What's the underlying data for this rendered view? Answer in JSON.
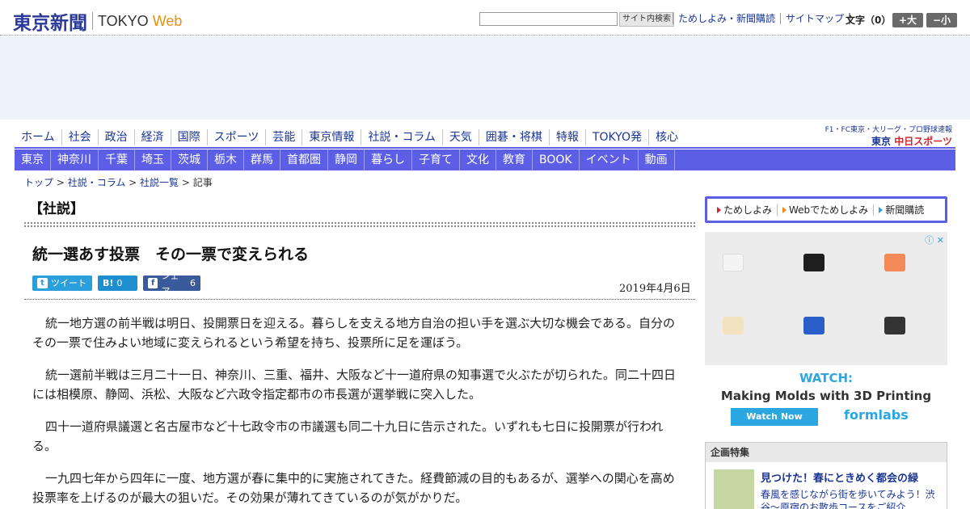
{
  "header": {
    "logo_jp": "東京新聞",
    "logo_en": "TOKYO",
    "logo_web": "Web",
    "search_button": "サイト内検索",
    "links": [
      "ためしよみ・新聞購読",
      "サイトマップ"
    ],
    "font_size_label": "文字（0）",
    "font_up": "+大",
    "font_down": "−小"
  },
  "nav_primary": [
    "ホーム",
    "社会",
    "政治",
    "経済",
    "国際",
    "スポーツ",
    "芸能",
    "東京情報",
    "社説・コラム",
    "天気",
    "囲碁・将棋",
    "特報",
    "TOKYO発",
    "核心"
  ],
  "partner": {
    "top": "F1・FC東京・大リーグ・プロ野球速報",
    "bottom_prefix": "東京",
    "bottom_brand": "中日スポーツ"
  },
  "nav_regional": [
    "東京",
    "神奈川",
    "千葉",
    "埼玉",
    "茨城",
    "栃木",
    "群馬",
    "首都圏",
    "静岡",
    "暮らし",
    "子育て",
    "文化",
    "教育",
    "BOOK",
    "イベント",
    "動画"
  ],
  "breadcrumb": {
    "top": "トップ",
    "column": "社説・コラム",
    "list": "社説一覧",
    "current": "記事",
    "sep": " > "
  },
  "article": {
    "category": "【社説】",
    "headline": "統一選あす投票　その一票で変えられる",
    "date": "2019年4月6日",
    "share": {
      "tweet": "ツイート",
      "hatena_count": "0",
      "facebook": "シェア",
      "facebook_count": "6"
    },
    "paragraphs": [
      "統一地方選の前半戦は明日、投開票日を迎える。暮らしを支える地方自治の担い手を選ぶ大切な機会である。自分のその一票で住みよい地域に変えられるという希望を持ち、投票所に足を運ぼう。",
      "統一選前半戦は三月二十一日、神奈川、三重、福井、大阪など十一道府県の知事選で火ぶたが切られた。同二十四日には相模原、静岡、浜松、大阪など六政令指定都市の市長選が選挙戦に突入した。",
      "四十一道府県議選と名古屋市など十七政令市の市議選も同二十九日に告示された。いずれも七日に投開票が行われる。",
      "一九四七年から四年に一度、地方選が春に集中的に実施されてきた。経費節減の目的もあるが、選挙への関心を高め投票率を上げるのが最大の狙いだ。その効果が薄れてきているのが気がかりだ。"
    ]
  },
  "sidebar": {
    "subscribe": [
      "ためしよみ",
      "Webでためしよみ",
      "新聞購読"
    ],
    "ad": {
      "watch": "WATCH:",
      "title": "Making Molds with 3D Printing",
      "button": "Watch Now",
      "brand": "formlabs"
    },
    "feature": {
      "heading": "企画特集",
      "title": "見つけた！春にときめく都会の緑",
      "text": "春風を感じながら街を歩いてみよう！渋谷～原宿のお散歩コースをご紹介"
    }
  }
}
